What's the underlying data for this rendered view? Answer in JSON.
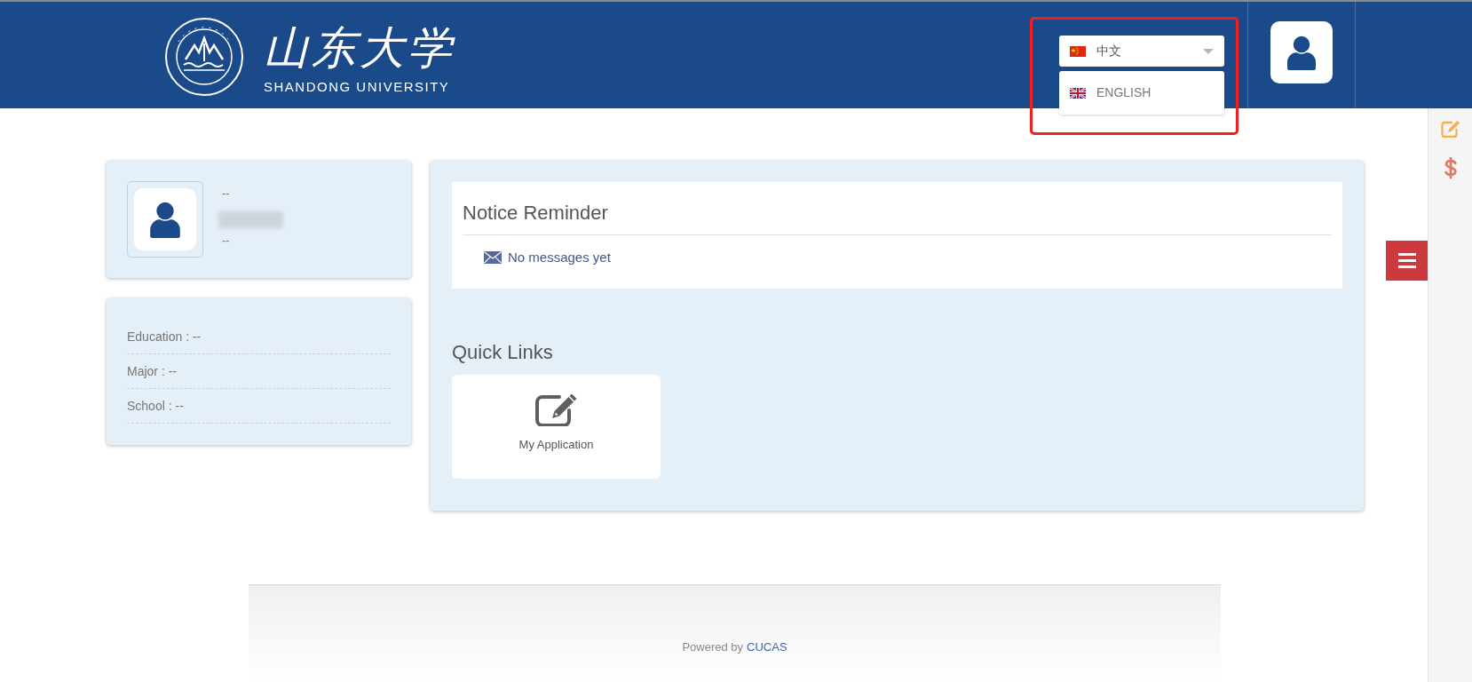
{
  "header": {
    "logo": {
      "title": "山东大学",
      "subtitle": "SHANDONG UNIVERSITY"
    },
    "language_select": {
      "value": "中文",
      "expanded": true,
      "options": [
        {
          "label": "ENGLISH",
          "selected": false
        }
      ]
    }
  },
  "profile_card": {
    "line_1": "--",
    "line_2": "--"
  },
  "details_card": {
    "rows": [
      "Education : --",
      "Major : --",
      "School : --"
    ]
  },
  "notice": {
    "title": "Notice Reminder",
    "message": "No messages yet"
  },
  "quick_links": {
    "title": "Quick Links",
    "items": [
      {
        "label": "My Application"
      }
    ]
  },
  "footer": {
    "text": "Powered by",
    "link": "CUCAS"
  }
}
